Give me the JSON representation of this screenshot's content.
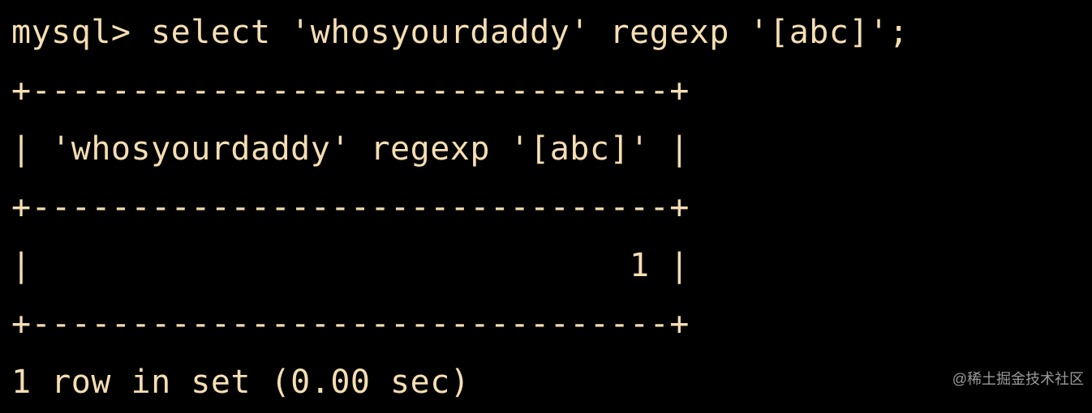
{
  "terminal": {
    "prompt": "mysql>",
    "command": "select 'whosyourdaddy' regexp '[abc]';",
    "border": "+--------------------------------+",
    "header": "| 'whosyourdaddy' regexp '[abc]' |",
    "row": "|                              1 |",
    "footer": "1 row in set (0.00 sec)"
  },
  "watermark": "@稀土掘金技术社区"
}
